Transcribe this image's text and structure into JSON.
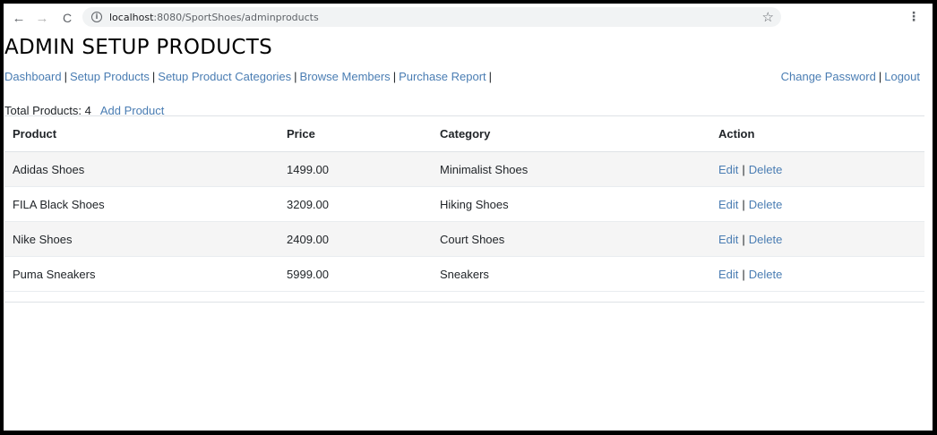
{
  "browser": {
    "url_host": "localhost",
    "url_rest": ":8080/SportShoes/adminproducts",
    "back_icon": "←",
    "forward_icon": "→",
    "reload_icon": "C",
    "info_icon": "i",
    "star_icon": "☆",
    "menu_icon": "⋮"
  },
  "page": {
    "title": "ADMIN SETUP PRODUCTS"
  },
  "nav": {
    "left": [
      "Dashboard",
      "Setup Products",
      "Setup Product Categories",
      "Browse Members",
      "Purchase Report"
    ],
    "separator": "|",
    "right": [
      "Change Password",
      "Logout"
    ]
  },
  "summary": {
    "total_label": "Total Products: 4",
    "add_label": "Add Product"
  },
  "table": {
    "headers": [
      "Product",
      "Price",
      "Category",
      "Action"
    ],
    "rows": [
      {
        "product": "Adidas Shoes",
        "price": "1499.00",
        "category": "Minimalist Shoes"
      },
      {
        "product": "FILA Black Shoes",
        "price": "3209.00",
        "category": "Hiking Shoes"
      },
      {
        "product": "Nike Shoes",
        "price": "2409.00",
        "category": "Court Shoes"
      },
      {
        "product": "Puma Sneakers",
        "price": "5999.00",
        "category": "Sneakers"
      }
    ],
    "edit_label": "Edit",
    "delete_label": "Delete",
    "action_separator": "|"
  },
  "colors": {
    "link": "#4a7db3",
    "stripe": "#f5f5f5"
  }
}
